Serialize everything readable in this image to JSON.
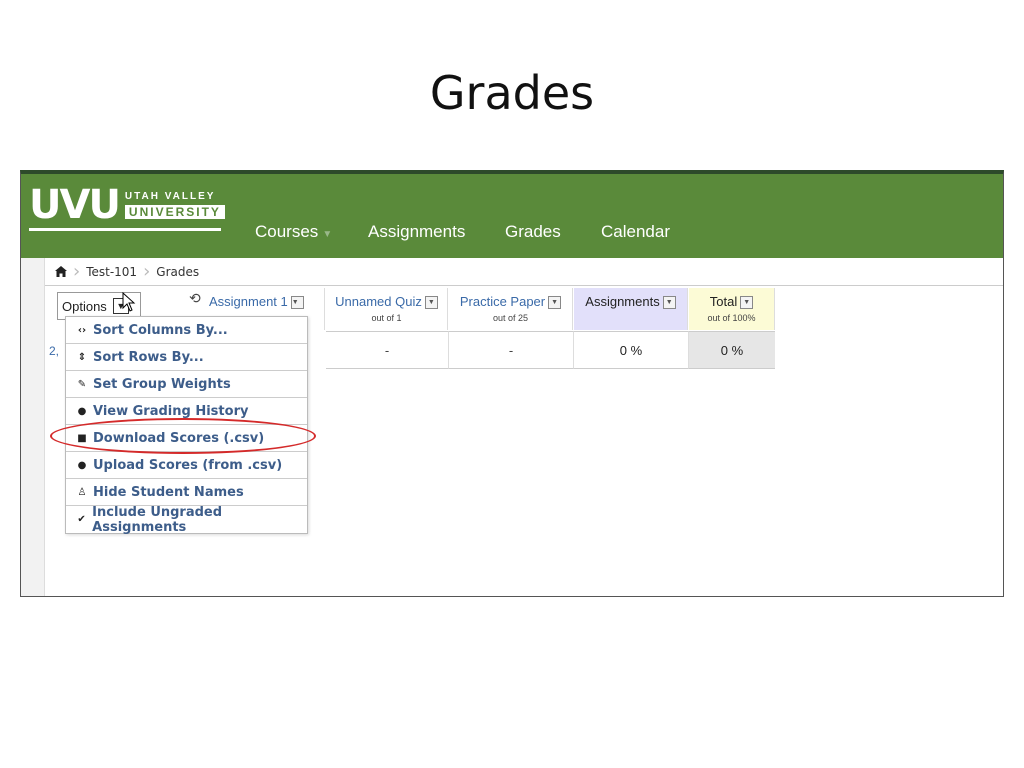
{
  "slide": {
    "title": "Grades"
  },
  "logo": {
    "mark": "UVU",
    "line1": "UTAH VALLEY",
    "line2": "UNIVERSITY"
  },
  "nav": {
    "courses": "Courses",
    "assignments": "Assignments",
    "grades": "Grades",
    "calendar": "Calendar"
  },
  "breadcrumb": {
    "course": "Test-101",
    "page": "Grades"
  },
  "toolbar": {
    "options_label": "Options"
  },
  "columns": [
    {
      "name": "Assignment 1",
      "sub": ""
    },
    {
      "name": "Unnamed Quiz",
      "sub": "out of 1"
    },
    {
      "name": "Practice Paper",
      "sub": "out of 25"
    },
    {
      "name": "Assignments",
      "sub": ""
    },
    {
      "name": "Total",
      "sub": "out of 100%"
    }
  ],
  "row": {
    "num": "2,",
    "quiz": "-",
    "paper": "-",
    "assignments": "0 %",
    "total": "0 %"
  },
  "menu": {
    "items": [
      {
        "label": "Sort Columns By...",
        "icon": "code-icon"
      },
      {
        "label": "Sort Rows By...",
        "icon": "sort-icon"
      },
      {
        "label": "Set Group Weights",
        "icon": "pencil-icon"
      },
      {
        "label": "View Grading History",
        "icon": "clock-icon"
      },
      {
        "label": "Download Scores (.csv)",
        "icon": "save-icon"
      },
      {
        "label": "Upload Scores (from .csv)",
        "icon": "clock-icon"
      },
      {
        "label": "Hide Student Names",
        "icon": "user-icon"
      },
      {
        "label": "Include Ungraded Assignments",
        "icon": "check-icon"
      }
    ]
  },
  "colors": {
    "navbar": "#5a8a3a",
    "link": "#3d5d8a",
    "assignments_col": "#e2e0fa",
    "total_col": "#fcfbd6",
    "highlight": "#d42a2a"
  }
}
